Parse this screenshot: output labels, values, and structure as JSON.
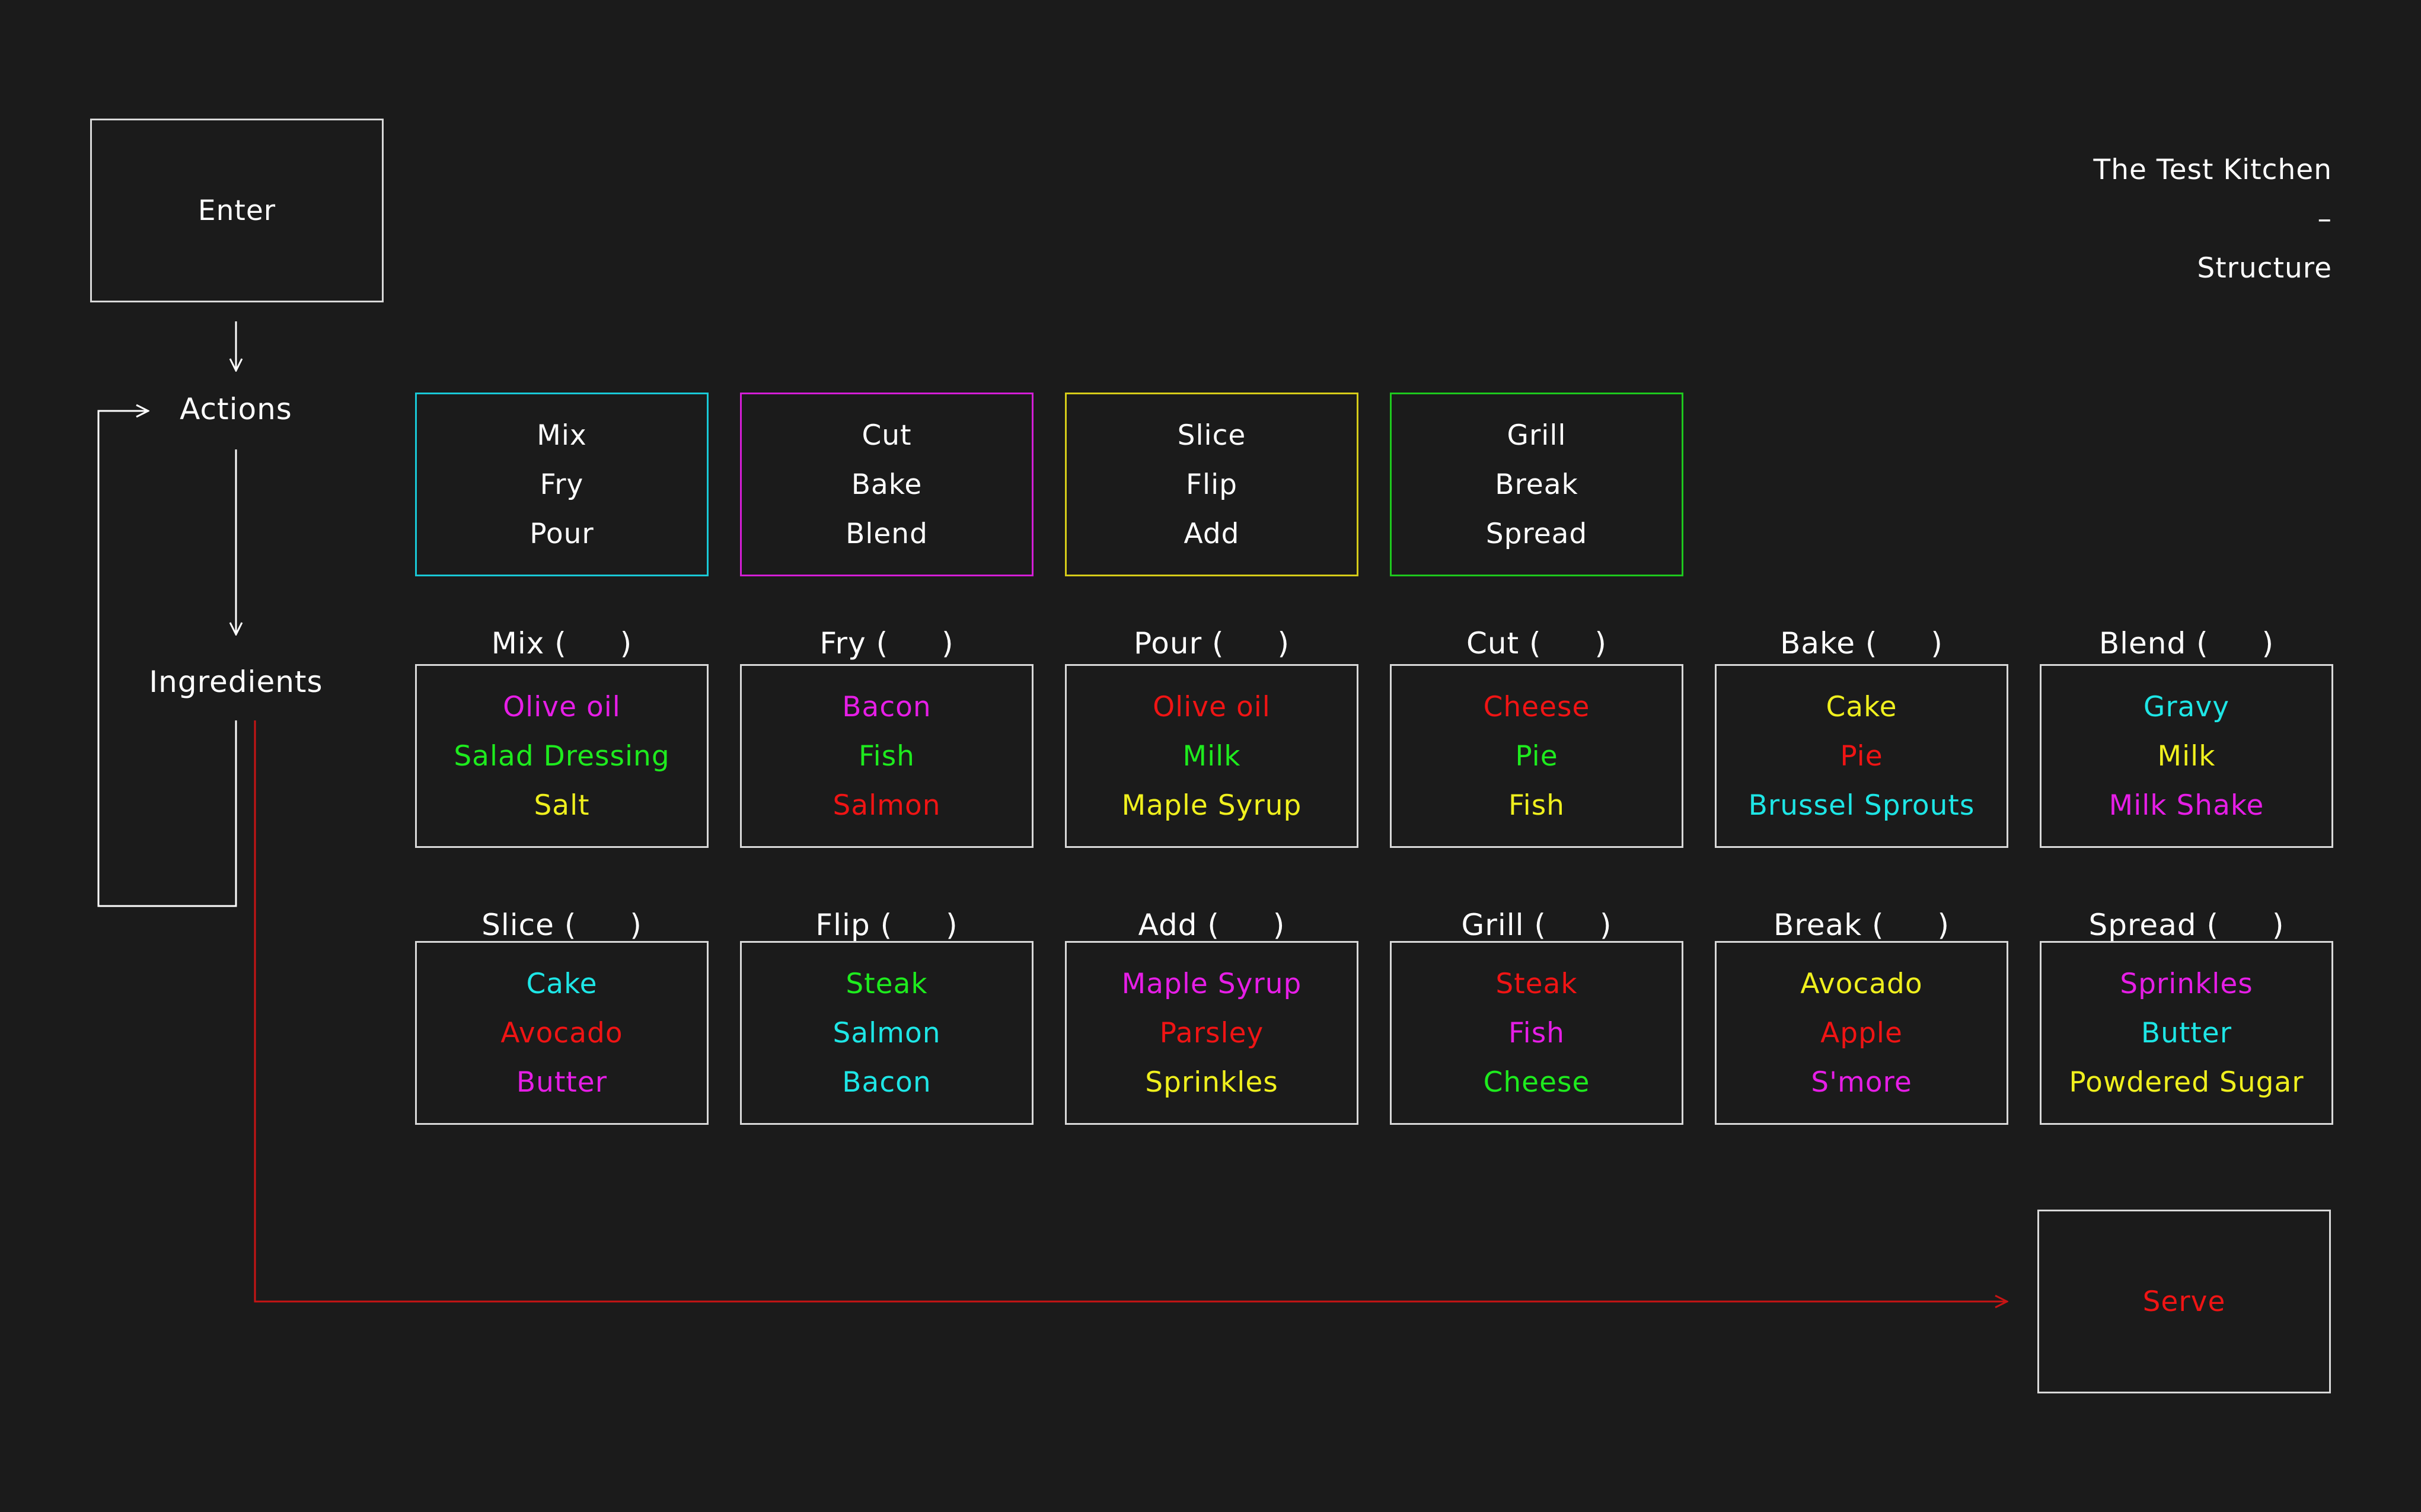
{
  "title": {
    "line1": "The Test Kitchen",
    "line2": "–",
    "line3": "Structure"
  },
  "flow": {
    "enter": "Enter",
    "actions": "Actions",
    "ingredients": "Ingredients",
    "serve": "Serve"
  },
  "action_groups": [
    {
      "color": "#19c8d6",
      "actions": [
        "Mix",
        "Fry",
        "Pour"
      ]
    },
    {
      "color": "#d41ed6",
      "actions": [
        "Cut",
        "Bake",
        "Blend"
      ]
    },
    {
      "color": "#d6cc19",
      "actions": [
        "Slice",
        "Flip",
        "Add"
      ]
    },
    {
      "color": "#1ec81e",
      "actions": [
        "Grill",
        "Break",
        "Spread"
      ]
    }
  ],
  "colors": {
    "cyan": "#1ee6e6",
    "magenta": "#e61ee6",
    "yellow": "#f0f01e",
    "green": "#1eeb1e",
    "red": "#f01414",
    "connector": "#ffffff",
    "serve_line": "#c81414"
  },
  "ingredient_rows": [
    [
      {
        "name": "Mix (",
        "close": ")",
        "items": [
          {
            "text": "Olive oil",
            "color": "magenta"
          },
          {
            "text": "Salad Dressing",
            "color": "green"
          },
          {
            "text": "Salt",
            "color": "yellow"
          }
        ]
      },
      {
        "name": "Fry (",
        "close": ")",
        "items": [
          {
            "text": "Bacon",
            "color": "magenta"
          },
          {
            "text": "Fish",
            "color": "green"
          },
          {
            "text": "Salmon",
            "color": "red"
          }
        ]
      },
      {
        "name": "Pour (",
        "close": ")",
        "items": [
          {
            "text": "Olive oil",
            "color": "red"
          },
          {
            "text": "Milk",
            "color": "green"
          },
          {
            "text": "Maple Syrup",
            "color": "yellow"
          }
        ]
      },
      {
        "name": "Cut (",
        "close": ")",
        "items": [
          {
            "text": "Cheese",
            "color": "red"
          },
          {
            "text": "Pie",
            "color": "green"
          },
          {
            "text": "Fish",
            "color": "yellow"
          }
        ]
      },
      {
        "name": "Bake (",
        "close": ")",
        "items": [
          {
            "text": "Cake",
            "color": "yellow"
          },
          {
            "text": "Pie",
            "color": "red"
          },
          {
            "text": "Brussel Sprouts",
            "color": "cyan"
          }
        ]
      },
      {
        "name": "Blend (",
        "close": ")",
        "items": [
          {
            "text": "Gravy",
            "color": "cyan"
          },
          {
            "text": "Milk",
            "color": "yellow"
          },
          {
            "text": "Milk Shake",
            "color": "magenta"
          }
        ]
      }
    ],
    [
      {
        "name": "Slice (",
        "close": ")",
        "items": [
          {
            "text": "Cake",
            "color": "cyan"
          },
          {
            "text": "Avocado",
            "color": "red"
          },
          {
            "text": "Butter",
            "color": "magenta"
          }
        ]
      },
      {
        "name": "Flip (",
        "close": ")",
        "items": [
          {
            "text": "Steak",
            "color": "green"
          },
          {
            "text": "Salmon",
            "color": "cyan"
          },
          {
            "text": "Bacon",
            "color": "cyan"
          }
        ]
      },
      {
        "name": "Add (",
        "close": ")",
        "items": [
          {
            "text": "Maple Syrup",
            "color": "magenta"
          },
          {
            "text": "Parsley",
            "color": "red"
          },
          {
            "text": "Sprinkles",
            "color": "yellow"
          }
        ]
      },
      {
        "name": "Grill (",
        "close": ")",
        "items": [
          {
            "text": "Steak",
            "color": "red"
          },
          {
            "text": "Fish",
            "color": "magenta"
          },
          {
            "text": "Cheese",
            "color": "green"
          }
        ]
      },
      {
        "name": "Break (",
        "close": ")",
        "items": [
          {
            "text": "Avocado",
            "color": "yellow"
          },
          {
            "text": "Apple",
            "color": "red"
          },
          {
            "text": "S'more",
            "color": "magenta"
          }
        ]
      },
      {
        "name": "Spread (",
        "close": ")",
        "items": [
          {
            "text": "Sprinkles",
            "color": "magenta"
          },
          {
            "text": "Butter",
            "color": "cyan"
          },
          {
            "text": "Powdered Sugar",
            "color": "yellow"
          }
        ]
      }
    ]
  ]
}
